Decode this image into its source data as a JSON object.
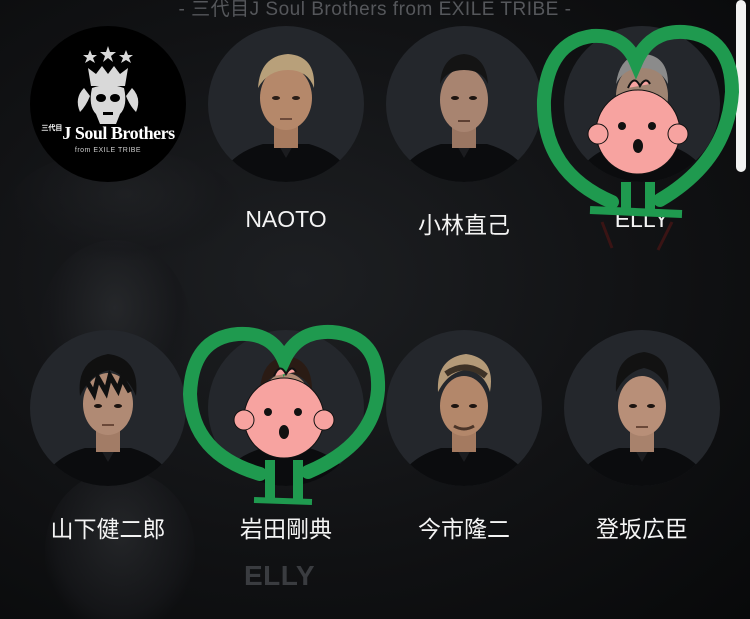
{
  "header": {
    "title": "- 三代目J Soul Brothers from EXILE TRIBE -"
  },
  "logo": {
    "line1": "J Soul Brothers",
    "line2": "from EXILE TRIBE",
    "side": "三代目"
  },
  "members": [
    {
      "name": "NAOTO"
    },
    {
      "name": "小林直己"
    },
    {
      "name": "ELLY"
    },
    {
      "name": "山下健二郎"
    },
    {
      "name": "岩田剛典"
    },
    {
      "name": "今市隆二"
    },
    {
      "name": "登坂広臣"
    }
  ],
  "background": {
    "ghost_text": "ELLY"
  },
  "colors": {
    "doodle_green": "#1f9a4f",
    "doodle_face": "#f7a3a0",
    "background": "#0d0e10"
  }
}
